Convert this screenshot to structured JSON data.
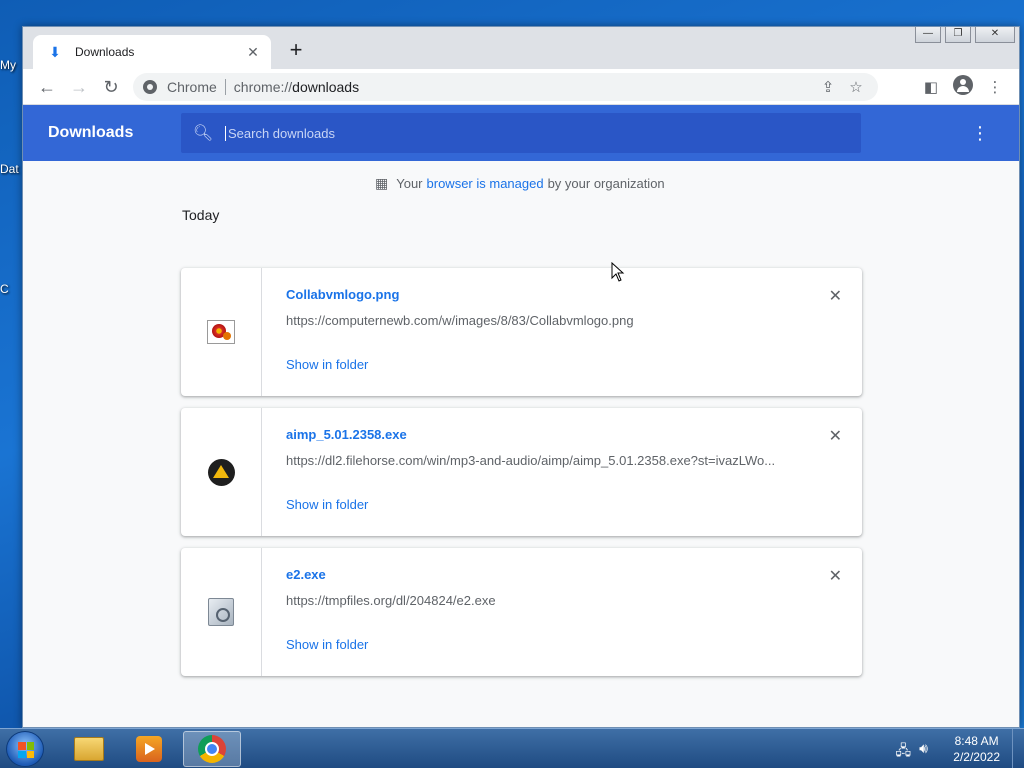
{
  "desktop": {
    "icon_labels": [
      "My",
      "Dat",
      "C"
    ]
  },
  "browser": {
    "tab": {
      "title": "Downloads"
    },
    "window_controls": {
      "minimize": "—",
      "restore": "❐",
      "close": "✕"
    },
    "omnibox": {
      "chip": "Chrome",
      "url_scheme": "chrome://",
      "url_host": "downloads"
    }
  },
  "downloads": {
    "header_title": "Downloads",
    "search_placeholder": "Search downloads",
    "managed": {
      "prefix": "Your",
      "link": "browser is managed",
      "suffix": "by your organization"
    },
    "section_label": "Today",
    "items": [
      {
        "name": "Collabvmlogo.png",
        "url": "https://computernewb.com/w/images/8/83/Collabvmlogo.png",
        "action": "Show in folder",
        "icon": "image-file-icon"
      },
      {
        "name": "aimp_5.01.2358.exe",
        "url": "https://dl2.filehorse.com/win/mp3-and-audio/aimp/aimp_5.01.2358.exe?st=ivazLWo...",
        "action": "Show in folder",
        "icon": "aimp-icon"
      },
      {
        "name": "e2.exe",
        "url": "https://tmpfiles.org/dl/204824/e2.exe",
        "action": "Show in folder",
        "icon": "exe-file-icon"
      }
    ]
  },
  "taskbar": {
    "clock_time": "8:48 AM",
    "clock_date": "2/2/2022",
    "accent": "#3367d6"
  }
}
